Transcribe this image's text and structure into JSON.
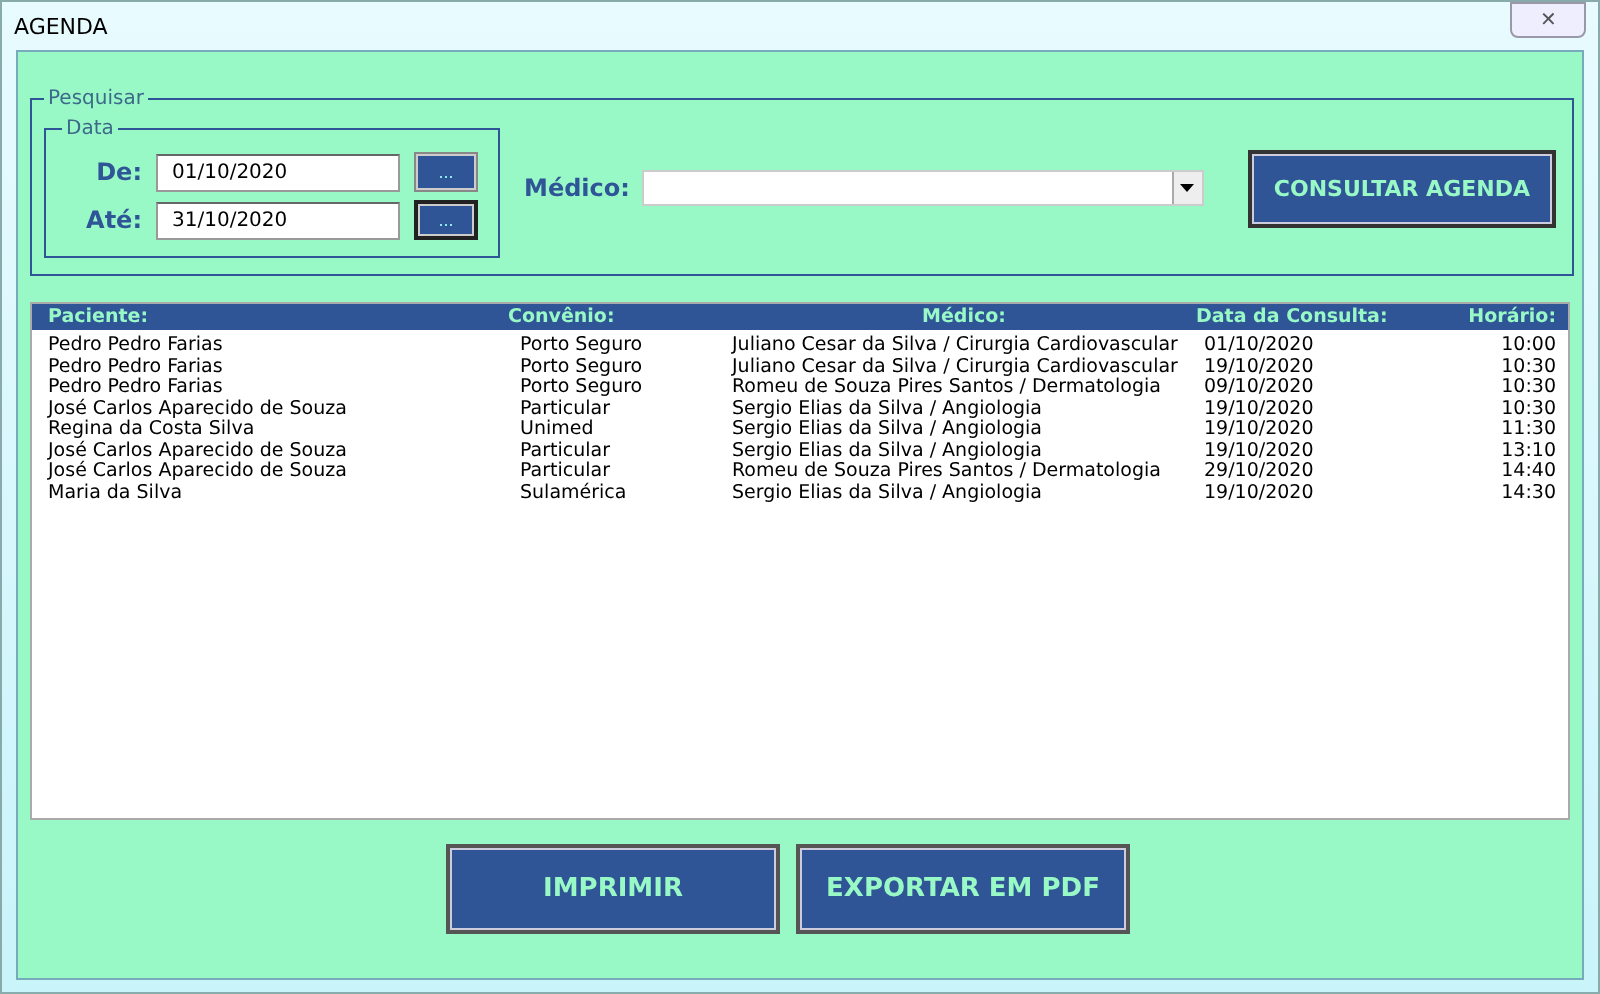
{
  "window": {
    "title": "AGENDA",
    "close": "✕"
  },
  "search": {
    "title": "Pesquisar",
    "date_group": {
      "title": "Data",
      "from_label": "De:",
      "from_value": "01/10/2020",
      "from_button": "...",
      "to_label": "Até:",
      "to_value": "31/10/2020",
      "to_button": "..."
    },
    "doctor_label": "Médico:",
    "submit": "CONSULTAR AGENDA"
  },
  "table": {
    "columns": [
      "Paciente:",
      "Convênio:",
      "Médico:",
      "Data da Consulta:",
      "Horário:"
    ],
    "rows": [
      [
        "Pedro Pedro Farias",
        "Porto Seguro",
        "Juliano Cesar da Silva / Cirurgia Cardiovascular",
        "01/10/2020",
        "10:00"
      ],
      [
        "Pedro Pedro Farias",
        "Porto Seguro",
        "Juliano Cesar da Silva / Cirurgia Cardiovascular",
        "19/10/2020",
        "10:30"
      ],
      [
        "Pedro Pedro Farias",
        "Porto Seguro",
        "Romeu de Souza Pires Santos / Dermatologia",
        "09/10/2020",
        "10:30"
      ],
      [
        "José Carlos Aparecido de Souza",
        "Particular",
        "Sergio Elias da Silva / Angiologia",
        "19/10/2020",
        "10:30"
      ],
      [
        "Regina da Costa Silva",
        "Unimed",
        "Sergio Elias da Silva / Angiologia",
        "19/10/2020",
        "11:30"
      ],
      [
        "José Carlos Aparecido de Souza",
        "Particular",
        "Sergio Elias da Silva / Angiologia",
        "19/10/2020",
        "13:10"
      ],
      [
        "José Carlos Aparecido de Souza",
        "Particular",
        "Romeu de Souza Pires Santos / Dermatologia",
        "29/10/2020",
        "14:40"
      ],
      [
        "Maria da Silva",
        "Sulamérica",
        "Sergio Elias da Silva / Angiologia",
        "19/10/2020",
        "14:30"
      ]
    ]
  },
  "buttons": [
    "IMPRIMIR",
    "EXPORTAR EM PDF"
  ]
}
